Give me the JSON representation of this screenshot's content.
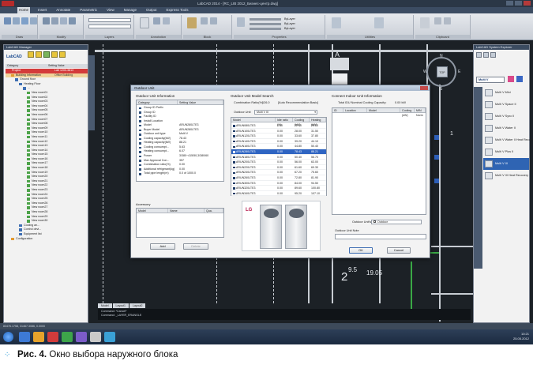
{
  "window": {
    "title": "LabCAD 2014 - [RC_LIB 2012_Бизнес-центр.dwg]"
  },
  "ribbon": {
    "tabs": [
      "Home",
      "Insert",
      "Annotate",
      "Parametric",
      "View",
      "Manage",
      "Output",
      "Express Tools"
    ],
    "active_tab": "Home",
    "groups": [
      "Draw",
      "Modify",
      "Layers",
      "Annotation",
      "Block",
      "Properties",
      "Utilities",
      "Clipboard"
    ],
    "properties_values": [
      "ByLayer",
      "ByLayer",
      "ByLayer"
    ]
  },
  "left_palette": {
    "title": "LabCAD Manager",
    "logo": "LabCAD",
    "columns": [
      "Category",
      "Setting Value"
    ],
    "tree": [
      {
        "indent": 0,
        "label": "Project",
        "value": "Lab 1200-3813",
        "state": "selected",
        "icon": "red"
      },
      {
        "indent": 1,
        "label": "Building Information",
        "value": "Office Building",
        "state": "highlight",
        "icon": "orange"
      },
      {
        "indent": 2,
        "label": "Ground floor",
        "value": "",
        "state": "",
        "icon": "blue"
      },
      {
        "indent": 3,
        "label": "Heating Floor",
        "value": "",
        "state": "",
        "icon": "blue"
      },
      {
        "indent": 4,
        "label": "...",
        "value": "",
        "state": "",
        "icon": "blue"
      },
      {
        "indent": 5,
        "label": "New room01",
        "value": "",
        "state": "",
        "icon": "green"
      },
      {
        "indent": 5,
        "label": "New room02",
        "value": "",
        "state": "",
        "icon": "green"
      },
      {
        "indent": 5,
        "label": "New room03",
        "value": "",
        "state": "",
        "icon": "green"
      },
      {
        "indent": 5,
        "label": "New room04",
        "value": "",
        "state": "",
        "icon": "green"
      },
      {
        "indent": 5,
        "label": "New room05",
        "value": "",
        "state": "",
        "icon": "green"
      },
      {
        "indent": 5,
        "label": "New room06",
        "value": "",
        "state": "",
        "icon": "green"
      },
      {
        "indent": 5,
        "label": "New room07",
        "value": "",
        "state": "",
        "icon": "green"
      },
      {
        "indent": 5,
        "label": "New room08",
        "value": "",
        "state": "",
        "icon": "green"
      },
      {
        "indent": 5,
        "label": "New room09",
        "value": "",
        "state": "",
        "icon": "green"
      },
      {
        "indent": 5,
        "label": "New room10",
        "value": "",
        "state": "",
        "icon": "green"
      },
      {
        "indent": 5,
        "label": "New room11",
        "value": "",
        "state": "",
        "icon": "green"
      },
      {
        "indent": 5,
        "label": "New room12",
        "value": "",
        "state": "",
        "icon": "green"
      },
      {
        "indent": 5,
        "label": "New room13",
        "value": "",
        "state": "",
        "icon": "green"
      },
      {
        "indent": 5,
        "label": "New room14",
        "value": "",
        "state": "",
        "icon": "green"
      },
      {
        "indent": 5,
        "label": "New room15",
        "value": "",
        "state": "",
        "icon": "green"
      },
      {
        "indent": 5,
        "label": "New room16",
        "value": "",
        "state": "",
        "icon": "green"
      },
      {
        "indent": 5,
        "label": "New room17",
        "value": "",
        "state": "",
        "icon": "green"
      },
      {
        "indent": 5,
        "label": "New room18",
        "value": "",
        "state": "",
        "icon": "green"
      },
      {
        "indent": 5,
        "label": "New room19",
        "value": "",
        "state": "",
        "icon": "green"
      },
      {
        "indent": 5,
        "label": "New room20",
        "value": "",
        "state": "",
        "icon": "green"
      },
      {
        "indent": 5,
        "label": "New room21",
        "value": "",
        "state": "",
        "icon": "green"
      },
      {
        "indent": 5,
        "label": "New room22",
        "value": "",
        "state": "",
        "icon": "green"
      },
      {
        "indent": 5,
        "label": "New room23",
        "value": "",
        "state": "",
        "icon": "green"
      },
      {
        "indent": 5,
        "label": "New room24",
        "value": "",
        "state": "",
        "icon": "green"
      },
      {
        "indent": 5,
        "label": "New room25",
        "value": "",
        "state": "",
        "icon": "green"
      },
      {
        "indent": 5,
        "label": "New room26",
        "value": "",
        "state": "",
        "icon": "green"
      },
      {
        "indent": 5,
        "label": "New room27",
        "value": "",
        "state": "",
        "icon": "green"
      },
      {
        "indent": 5,
        "label": "New room28",
        "value": "",
        "state": "",
        "icon": "green"
      },
      {
        "indent": 5,
        "label": "New room29",
        "value": "",
        "state": "",
        "icon": "green"
      },
      {
        "indent": 5,
        "label": "New room30",
        "value": "",
        "state": "",
        "icon": "green"
      },
      {
        "indent": 3,
        "label": "Cooling an...",
        "value": "",
        "state": "",
        "icon": "blue"
      },
      {
        "indent": 3,
        "label": "Control devi...",
        "value": "",
        "state": "",
        "icon": "blue"
      },
      {
        "indent": 3,
        "label": "Equipment list",
        "value": "",
        "state": "",
        "icon": "blue"
      },
      {
        "indent": 1,
        "label": "Configuration",
        "value": "",
        "state": "",
        "icon": "orange"
      }
    ]
  },
  "right_palette": {
    "title": "LabCAD System Explorer",
    "brand": "Multi V",
    "items": [
      {
        "label": "Multi V Mini",
        "selected": false
      },
      {
        "label": "Multi V Space II",
        "selected": false
      },
      {
        "label": "Multi V Sync II",
        "selected": false
      },
      {
        "label": "Multi V Water II",
        "selected": false
      },
      {
        "label": "Multi V Water II Heat Recovery",
        "selected": false
      },
      {
        "label": "Multi V Plus II",
        "selected": false
      },
      {
        "label": "Multi V III",
        "selected": true
      },
      {
        "label": "Multi V III Heat Recovery",
        "selected": false
      }
    ]
  },
  "dialog": {
    "title": "Outdoor Unit",
    "info_section": "Outdoor Unit Information",
    "info_columns": [
      "Category",
      "Setting Value"
    ],
    "info_rows": [
      {
        "k": "Group ID Prefix",
        "v": ""
      },
      {
        "k": "Group ID",
        "v": ""
      },
      {
        "k": "Facility ID",
        "v": ""
      },
      {
        "k": "Install Location",
        "v": ""
      },
      {
        "k": "Model",
        "v": "ARUN280LTE3"
      },
      {
        "k": "Buyer Model",
        "v": "ARUN280LTE3"
      },
      {
        "k": "Outdoor unit type",
        "v": "Multi V"
      },
      {
        "k": "Cooling capacity(kW)",
        "v": "78.43"
      },
      {
        "k": "Heating capacity(kW)",
        "v": "88.21"
      },
      {
        "k": "Cooling consumpt...",
        "v": "5.63"
      },
      {
        "k": "Heating consumpt...",
        "v": "6.07"
      },
      {
        "k": "Power",
        "v": "3/380~415/50,3/380/60"
      },
      {
        "k": "Max Approval Con...",
        "v": "357"
      },
      {
        "k": "Combination ratio(%)",
        "v": "0.00"
      },
      {
        "k": "Additional refrigerant(kg)",
        "v": "0.00"
      },
      {
        "k": "Total pipe length(m)",
        "v": "0.0 of 1000.0"
      }
    ],
    "accessory_label": "Accessory",
    "accessory_columns": [
      "Model",
      "Name",
      "Qua."
    ],
    "add_button": "Add",
    "delete_button": "Delete",
    "search_section": "Outdoor Unit Model Search",
    "combination_label": "Combination Ratio(%)",
    "combination_value": "126.0",
    "auto_recommend": "[Auto Recommendation Basic]",
    "outdoor_unit_label": "Outdoor Unit",
    "outdoor_unit_value": "Multi V III",
    "model_columns": [
      "Model",
      "Idle ratio (%)",
      "Cooling (kW)",
      "Heating (kW)"
    ],
    "models": [
      {
        "m": "ARUN080LTE3",
        "a": "0.00",
        "b": "22.40",
        "c": "25.20",
        "sel": false
      },
      {
        "m": "ARUN100LTE3",
        "a": "0.00",
        "b": "28.00",
        "c": "31.50",
        "sel": false
      },
      {
        "m": "ARUN120LTE3",
        "a": "0.00",
        "b": "33.60",
        "c": "37.80",
        "sel": false
      },
      {
        "m": "ARUN140LTE3",
        "a": "0.00",
        "b": "39.20",
        "c": "44.10",
        "sel": false
      },
      {
        "m": "ARUN160LTE3",
        "a": "0.00",
        "b": "44.80",
        "c": "50.40",
        "sel": false
      },
      {
        "m": "ARUN280LTE3",
        "a": "0.00",
        "b": "78.43",
        "c": "88.21",
        "sel": true
      },
      {
        "m": "ARUN180LTE3",
        "a": "0.00",
        "b": "50.40",
        "c": "56.70",
        "sel": false
      },
      {
        "m": "ARUN200LTE3",
        "a": "0.00",
        "b": "56.00",
        "c": "63.00",
        "sel": false
      },
      {
        "m": "ARUN220LTE3",
        "a": "0.00",
        "b": "61.60",
        "c": "69.30",
        "sel": false
      },
      {
        "m": "ARUN240LTE3",
        "a": "0.00",
        "b": "67.20",
        "c": "75.60",
        "sel": false
      },
      {
        "m": "ARUN260LTE3",
        "a": "0.00",
        "b": "72.80",
        "c": "81.90",
        "sel": false
      },
      {
        "m": "ARUN300LTE3",
        "a": "0.00",
        "b": "84.00",
        "c": "94.50",
        "sel": false
      },
      {
        "m": "ARUN320LTE3",
        "a": "0.00",
        "b": "89.60",
        "c": "100.80",
        "sel": false
      },
      {
        "m": "ARUN340LTE3",
        "a": "0.00",
        "b": "95.20",
        "c": "107.10",
        "sel": false
      }
    ],
    "brand_logo": "LG",
    "connect_section": "Connect Indoor Unit Information",
    "total_capacity_label": "Total IDU Nominal Cooling Capacity:",
    "total_capacity_value": "0.00 kW",
    "connect_columns": [
      "ID",
      "Location",
      "Model",
      "Cooling (kW)",
      "MIN Norm"
    ],
    "outdoor_unit_s_label": "Outdoor Unit's",
    "outdoor_unit_s_value": "Outdoor",
    "outdoor_unit_note_label": "Outdoor Unit Note",
    "ok_button": "OK",
    "cancel_button": "Cancel"
  },
  "canvas": {
    "label_a": "A",
    "label_b": "B",
    "label_1": "1",
    "label_2": "2",
    "dimension_text": "9.5",
    "coord_text": "19.05",
    "compass": {
      "n": "N",
      "s": "S",
      "w": "W",
      "e": "E",
      "top": "TOP"
    }
  },
  "layout_tabs": [
    "Model",
    "Layout1",
    "Layout2"
  ],
  "command_lines": [
    "Command: *Cancel*",
    "Command: _LAYER_ERANGLE"
  ],
  "status_text": "83476.1758, 31467.3086, 0.0000",
  "clock": {
    "time": "10:21",
    "date": "25.05.2012"
  },
  "caption": {
    "prefix": "Рис. 4.",
    "text": "Окно выбора наружного блока"
  },
  "colors": {
    "canvas_bg": "#1c2126",
    "selection_blue": "#2e64c2",
    "selection_red": "#d43b3b",
    "caption_accent": "#2a9ad6"
  }
}
